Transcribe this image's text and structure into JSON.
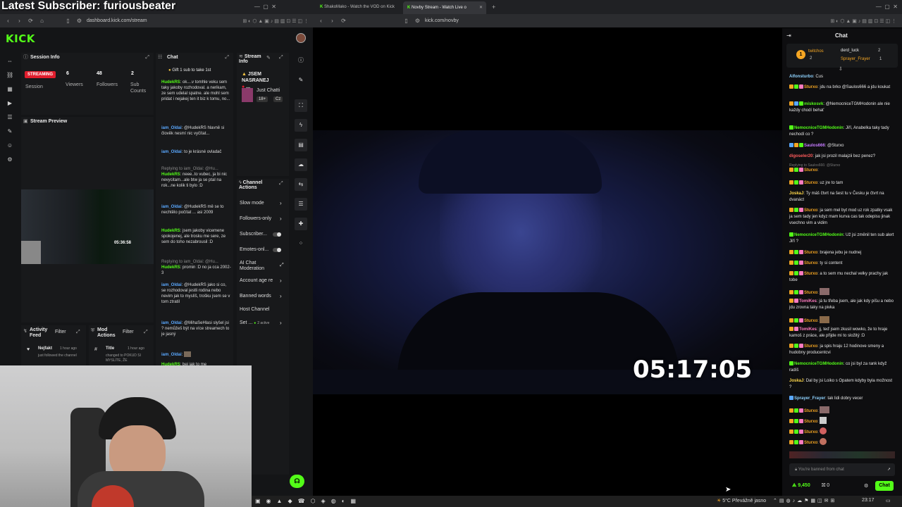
{
  "overlay": {
    "title": "Latest Subscriber: furiousbeater"
  },
  "left_browser": {
    "tabs": [
      {
        "label": "ShakoMako - Watch the VOD on Kick"
      }
    ],
    "url": "dashboard.kick.com/stream"
  },
  "right_browser": {
    "tabs": [
      {
        "label": "ShakoMako - Watch the VOD on Kick"
      },
      {
        "label": "Novby Stream - Watch Live o"
      }
    ],
    "url": "kick.com/novby"
  },
  "dashboard": {
    "logo": "KICK",
    "session": {
      "title": "Session Info",
      "status": "STREAMING",
      "session_label": "Session",
      "viewers_value": "6",
      "viewers_label": "Viewers",
      "followers_value": "48",
      "followers_label": "Followers",
      "subs_value": "2",
      "subs_label": "Sub Counts"
    },
    "preview": {
      "title": "Stream Preview",
      "thumb_time": "05:36:58"
    },
    "chat": {
      "title": "Chat",
      "pinned": "Gift 1 sub to take 1st",
      "messages": [
        {
          "user": "HudekRS",
          "text": "ok....v tomhle veku sem taky jakoby rozhodoval. a nerikam, ze sem udelal spatne. ale mohl sem pridat i nejakej ten it biz k tomu, no..."
        },
        {
          "user": "iam_Oldai",
          "text": "@HudekRS hlavně si člověk nesmí nic vyčítat..."
        },
        {
          "user": "iam_Oldai",
          "text": "to je krásné ovladač"
        },
        {
          "user": "HudekRS",
          "reply": "Replying to iam_Oldai: @Hu...",
          "text": "neee..to vubec, ja bi nic nevycitam...ale btw ja se ptal na rok...ne kolik ti bylo :D"
        },
        {
          "user": "iam_Oldai",
          "text": "@HudekRS mě se to nechtělo počítat ... asi 2009"
        },
        {
          "user": "HudekRS",
          "text": "jsem jakoby vicemene spokojenej, ale trosku me sere, ze sem do toho nezabrousil :D"
        },
        {
          "user": "HudekRS",
          "reply": "Replying to iam_Oldai: @Hu...",
          "text": "promin :D no ja cca 2002-3"
        },
        {
          "user": "iam_Oldai",
          "text": "@HudekRS jako si co, se rozhodoval jestli rodina nebo nevim jak to myslíš, trošku jsem se v tom ztratil"
        },
        {
          "user": "iam_Oldai",
          "text": "@MihaSeHlasi slyšel jsi ? nemůžeš být na více streamech to je jasný"
        },
        {
          "user": "iam_Oldai",
          "text": ""
        },
        {
          "user": "HudekRS",
          "text": "bej jak to me"
        }
      ]
    },
    "stream_info": {
      "title": "Stream Info",
      "stream_title": "JSEM NASRANEJ",
      "category": "Just Chatti",
      "tags": [
        "18+",
        "Cz"
      ]
    },
    "channel_actions": {
      "title": "Channel Actions",
      "items": [
        {
          "label": "Slow mode"
        },
        {
          "label": "Followers-only"
        },
        {
          "label": "Subscriber..."
        },
        {
          "label": "Emotes-onl..."
        },
        {
          "label": "AI Chat Moderation"
        },
        {
          "label": "Account age re"
        },
        {
          "label": "Banned words"
        },
        {
          "label": "Host Channel"
        },
        {
          "label": "Set ...",
          "extra": "2 active"
        }
      ]
    },
    "activity": {
      "title": "Activity Feed",
      "filter": "Filter",
      "user": "Nejfakt",
      "time": "1 hour ago",
      "text": "just followed the channel"
    },
    "mod_actions": {
      "title": "Mod Actions",
      "filter": "Filter",
      "user": "Title",
      "time": "1 hour ago",
      "text": "changed to POKUD SI MYSLÍTE, ŽE"
    }
  },
  "stream": {
    "timer": "05:17:05"
  },
  "chat_panel": {
    "title": "Chat",
    "top_gifters": [
      {
        "user": "twitchos",
        "count": "2"
      },
      {
        "user": "derd_luck",
        "count": "2"
      },
      {
        "user": "Sprayer_Frayer",
        "count": "1"
      }
    ],
    "messages": [
      {
        "user": "Alfonsturbo",
        "color": "n-lb",
        "text": "Cus"
      },
      {
        "user": "Sturxo",
        "color": "n-o",
        "text": "jdu na brko @Saulos666 a jdu koukat"
      },
      {
        "user": "miskosvk",
        "color": "n-g",
        "text": "@NemocniceTGMHodonin ale nie každy chodí behať"
      },
      {
        "user": "NemocniceTGMHodonin",
        "color": "n-g",
        "text": "Jiří, Anabelka taky tady nechodí co ?"
      },
      {
        "user": "Saulos666",
        "color": "n-p",
        "text": "@Sturxo"
      },
      {
        "user": "digoseler20",
        "color": "n-r",
        "text": "jak jsi prozil malajzii bez penez?"
      },
      {
        "user": "Sturxo",
        "color": "n-o",
        "reply": "Replying to Saulos666: @Sturxo",
        "text": ""
      },
      {
        "user": "Sturxo",
        "color": "n-o",
        "text": "uz jre to tam"
      },
      {
        "user": "JoskaJ",
        "color": "n-y",
        "text": "Ty máš čtvrt na šest tu v Česku je čtvrt na dvanáct"
      },
      {
        "user": "Sturxo",
        "color": "n-o",
        "text": "ja sem mel byt mod uz rok zpatky vsak ja sem tady jen kdyz mam kurva cas tak odepisu jinak vsechno vim a vidim"
      },
      {
        "user": "NemocniceTGMHodonin",
        "color": "n-g",
        "text": "Už jsi změnil ten sub alert Jiří ?"
      },
      {
        "user": "Sturxo",
        "color": "n-o",
        "text": "brajena jebu je nudnej"
      },
      {
        "user": "Sturxo",
        "color": "n-o",
        "text": "ty si content"
      },
      {
        "user": "Sturxo",
        "color": "n-o",
        "text": "a to sem mu nechal velky prachy jak tobe"
      },
      {
        "user": "Sturxo",
        "color": "n-o",
        "text": ""
      },
      {
        "user": "TomiKes",
        "color": "n-pk",
        "text": "já tu třeba jsem, ale jak kdy píšu a nebo jdu zrovna taky na pivka"
      },
      {
        "user": "Sturxo",
        "color": "n-o",
        "text": ""
      },
      {
        "user": "TomiKes",
        "color": "n-pk",
        "text": "jj, teď jsem zkusil wowko, že to hraje kamoš z práce, ale přijde mi to složitý :D"
      },
      {
        "user": "Sturxo",
        "color": "n-o",
        "text": "ja spis hraju 12 hodinove smeny a hudobny producentcvi"
      },
      {
        "user": "NemocniceTGMHodonin",
        "color": "n-g",
        "text": "co jsi byl za rank když radíš"
      },
      {
        "user": "JoskaJ",
        "color": "n-y",
        "text": "Dal by jsi Loiko s Opatem kdyby byla možnost ?"
      },
      {
        "user": "Sprayer_Frayer",
        "color": "n-lb",
        "text": "tak lidi dobry vecer"
      },
      {
        "user": "Sturxo",
        "color": "n-o",
        "text": ""
      },
      {
        "user": "Sturxo",
        "color": "n-o",
        "text": ""
      },
      {
        "user": "Sturxo",
        "color": "n-o",
        "text": ""
      },
      {
        "user": "Sturxo",
        "color": "n-o",
        "text": ""
      }
    ],
    "banned_placeholder": "You're banned from chat",
    "points": "9,450",
    "gifts": "0",
    "chat_button": "Chat"
  },
  "taskbar": {
    "weather": "5°C Převážně jasno",
    "time": "23:17"
  },
  "colors": {
    "kick_green": "#53fc18",
    "live_red": "#e01d2d"
  }
}
